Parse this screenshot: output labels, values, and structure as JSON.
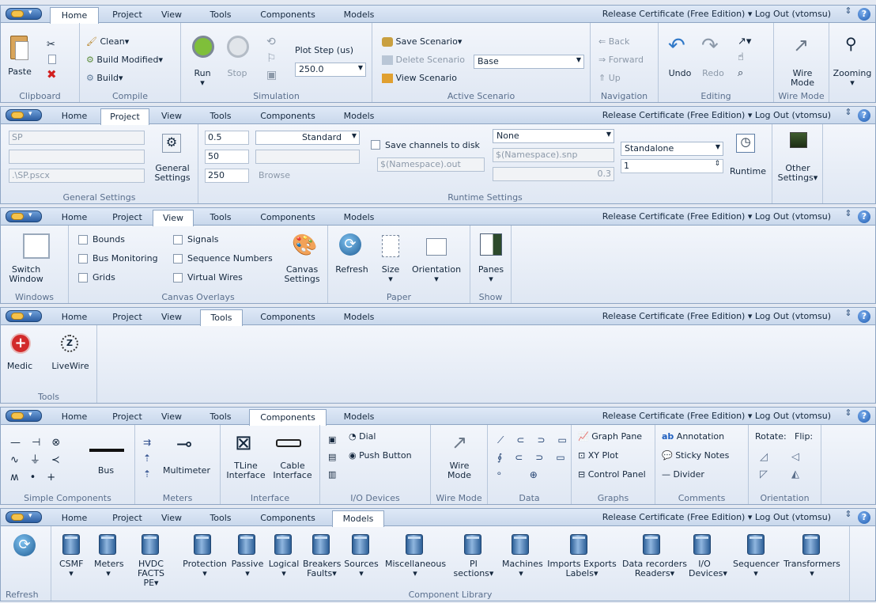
{
  "common": {
    "release": "Release Certificate (Free Edition)",
    "logout": "Log Out (vtomsu)",
    "help": "?",
    "updown": "⇕",
    "caret": "▾",
    "tabs": [
      "Home",
      "Project",
      "View",
      "Tools",
      "Components",
      "Models"
    ]
  },
  "home": {
    "clipboard": {
      "paste": "Paste",
      "label": "Clipboard"
    },
    "compile": {
      "clean": "Clean",
      "build_modified": "Build Modified",
      "build": "Build",
      "label": "Compile"
    },
    "simulation": {
      "run": "Run",
      "stop": "Stop",
      "plot_step_label": "Plot Step (us)",
      "plot_step_value": "250.0",
      "label": "Simulation"
    },
    "scenario": {
      "save": "Save Scenario",
      "delete": "Delete Scenario",
      "view": "View Scenario",
      "value": "Base",
      "label": "Active Scenario"
    },
    "navigation": {
      "back": "Back",
      "forward": "Forward",
      "up": "Up",
      "label": "Navigation"
    },
    "editing": {
      "undo": "Undo",
      "redo": "Redo",
      "label": "Editing"
    },
    "wiremode": {
      "button": "Wire Mode",
      "label": "Wire Mode"
    },
    "zooming": "Zooming"
  },
  "project": {
    "general": {
      "name": "SP",
      "path": ".\\SP.pscx",
      "button": "General Settings",
      "label": "General Settings"
    },
    "runtime": {
      "v1": "0.5",
      "v2": "50",
      "v3": "250",
      "standard": "Standard",
      "browse": "Browse",
      "save_channels": "Save channels to disk",
      "out": "$(Namespace).out",
      "none": "None",
      "snp": "$(Namespace).snp",
      "snp_val": "0.3",
      "standalone": "Standalone",
      "spin": "1",
      "runtime_btn": "Runtime",
      "label": "Runtime Settings"
    },
    "other": "Other Settings"
  },
  "view": {
    "windows": {
      "switch": "Switch Window",
      "label": "Windows"
    },
    "overlays": {
      "bounds": "Bounds",
      "bus_monitoring": "Bus Monitoring",
      "grids": "Grids",
      "signals": "Signals",
      "sequence_numbers": "Sequence Numbers",
      "virtual_wires": "Virtual Wires",
      "canvas_settings": "Canvas Settings",
      "label": "Canvas Overlays"
    },
    "paper": {
      "refresh": "Refresh",
      "size": "Size",
      "orientation": "Orientation",
      "label": "Paper"
    },
    "show": {
      "panes": "Panes",
      "label": "Show"
    }
  },
  "tools": {
    "medic": "Medic",
    "livewire": "LiveWire",
    "label": "Tools"
  },
  "components": {
    "simple": {
      "bus": "Bus",
      "label": "Simple Components"
    },
    "meters": {
      "multimeter": "Multimeter",
      "label": "Meters"
    },
    "interface": {
      "tline": "TLine Interface",
      "cable": "Cable Interface",
      "label": "Interface"
    },
    "io": {
      "dial": "Dial",
      "push": "Push Button",
      "label": "I/O Devices"
    },
    "wiremode": {
      "button": "Wire Mode",
      "label": "Wire Mode"
    },
    "data": {
      "label": "Data"
    },
    "graphs": {
      "graph_pane": "Graph Pane",
      "xy_plot": "XY Plot",
      "control_panel": "Control Panel",
      "label": "Graphs"
    },
    "comments": {
      "annotation": "Annotation",
      "sticky": "Sticky Notes",
      "divider": "Divider",
      "label": "Comments"
    },
    "orientation": {
      "rotate": "Rotate:",
      "flip": "Flip:",
      "label": "Orientation"
    }
  },
  "models": {
    "refresh": "Refresh",
    "library": [
      "CSMF",
      "Meters",
      "HVDC FACTS PE",
      "Protection",
      "Passive",
      "Logical",
      "Breakers Faults",
      "Sources",
      "Miscellaneous",
      "PI sections",
      "Machines",
      "Imports Exports Labels",
      "Data recorders Readers",
      "I/O Devices",
      "Sequencer",
      "Transformers"
    ],
    "label": "Component Library"
  }
}
